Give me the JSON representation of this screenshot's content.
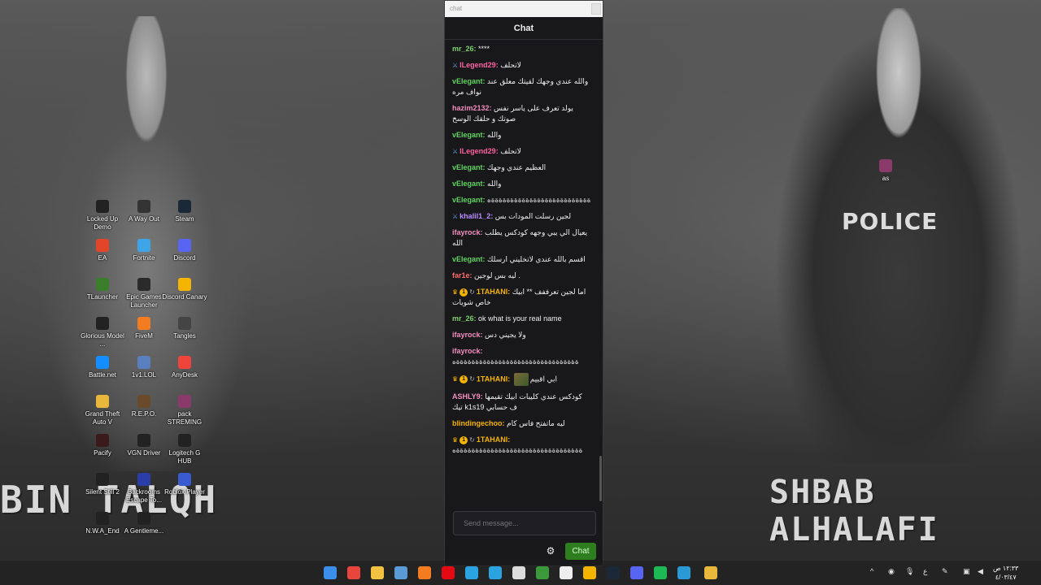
{
  "wallpaper": {
    "left_title": "BIN TALQH",
    "right_title": "SHBAB ALHALAFI",
    "police_text": "POLICE"
  },
  "desktop": {
    "icons": [
      {
        "label": "Locked Up Demo",
        "icon": "lu-icon",
        "color": "#222222"
      },
      {
        "label": "A Way Out",
        "icon": "awayout-icon",
        "color": "#333333"
      },
      {
        "label": "Steam",
        "icon": "steam-icon",
        "color": "#1b2838"
      },
      {
        "label": "EA",
        "icon": "ea-icon",
        "color": "#e2462a"
      },
      {
        "label": "Fortnite",
        "icon": "fortnite-icon",
        "color": "#3ea6e8"
      },
      {
        "label": "Discord",
        "icon": "discord-icon",
        "color": "#5865f2"
      },
      {
        "label": "TLauncher",
        "icon": "tlauncher-icon",
        "color": "#3a7d2a"
      },
      {
        "label": "Epic Games Launcher",
        "icon": "epic-icon",
        "color": "#2a2a2a"
      },
      {
        "label": "Discord Canary",
        "icon": "discord-canary-icon",
        "color": "#f5b400"
      },
      {
        "label": "Glorious Model ...",
        "icon": "glorious-icon",
        "color": "#222222"
      },
      {
        "label": "FiveM",
        "icon": "fivem-icon",
        "color": "#f47c20"
      },
      {
        "label": "Tangles",
        "icon": "tangles-icon",
        "color": "#444444"
      },
      {
        "label": "Battle.net",
        "icon": "battlenet-icon",
        "color": "#148eff"
      },
      {
        "label": "1v1.LOL",
        "icon": "1v1lol-icon",
        "color": "#5a7fbf"
      },
      {
        "label": "AnyDesk",
        "icon": "anydesk-icon",
        "color": "#ef443b"
      },
      {
        "label": "Grand Theft Auto V",
        "icon": "folder-icon",
        "color": "#e8b73c"
      },
      {
        "label": "R.E.P.O.",
        "icon": "repo-icon",
        "color": "#6a4a2a"
      },
      {
        "label": "pack STREMING",
        "icon": "winrar-icon",
        "color": "#8a3a6a"
      },
      {
        "label": "Pacify",
        "icon": "pacify-icon",
        "color": "#3a1a1a"
      },
      {
        "label": "VGN Driver",
        "icon": "vgn-icon",
        "color": "#222222"
      },
      {
        "label": "Logitech G HUB",
        "icon": "ghub-icon",
        "color": "#222222"
      },
      {
        "label": "Silent Still 2",
        "icon": "silentstill-icon",
        "color": "#222222"
      },
      {
        "label": "Backrooms Escape To...",
        "icon": "backrooms-icon",
        "color": "#2b3ea8"
      },
      {
        "label": "Roblox Player",
        "icon": "roblox-icon",
        "color": "#3a5acf"
      },
      {
        "label": "N.W.A_End",
        "icon": "nwa-icon",
        "color": "#222222"
      },
      {
        "label": "A Gentleme...",
        "icon": "gentleman-icon",
        "color": "#222222"
      },
      {
        "label": "as",
        "icon": "winrar-icon",
        "color": "#8a3a6a"
      }
    ]
  },
  "chat": {
    "window_title": "chat",
    "header": "Chat",
    "messages": [
      {
        "badges": [],
        "user": "mr_26",
        "color": "#7bd06b",
        "text": "****"
      },
      {
        "badges": [
          "sword"
        ],
        "user": "lLegend29",
        "color": "#ff5fa2",
        "text": "لاتحلف"
      },
      {
        "badges": [],
        "user": "vElegant",
        "color": "#5fd35f",
        "text": "والله عندي وجهك لقيتك معلق عند نواف مره"
      },
      {
        "badges": [],
        "user": "hazim2132",
        "color": "#f28dbf",
        "text": "يولد تعرف على ياسر نفس صوتك و حلقك الوسخ"
      },
      {
        "badges": [],
        "user": "vElegant",
        "color": "#5fd35f",
        "text": "والله"
      },
      {
        "badges": [
          "sword"
        ],
        "user": "lLegend29",
        "color": "#ff5fa2",
        "text": "لاتحلف"
      },
      {
        "badges": [],
        "user": "vElegant",
        "color": "#5fd35f",
        "text": "العظيم عندي وجهك"
      },
      {
        "badges": [],
        "user": "vElegant",
        "color": "#5fd35f",
        "text": "والله"
      },
      {
        "badges": [],
        "user": "vElegant",
        "color": "#5fd35f",
        "text": "ةةةةةةةةةةةةةةةةةةةةةةةةةةه"
      },
      {
        "badges": [
          "sword"
        ],
        "user": "khalil1_2",
        "color": "#b88cff",
        "text": "لجين رسلت المودات بس"
      },
      {
        "badges": [],
        "user": "ifayrock",
        "color": "#f28dbf",
        "text": "يعيال الي يبي وجهه كودكس يطلب الله"
      },
      {
        "badges": [],
        "user": "vElegant",
        "color": "#5fd35f",
        "text": "اقسم بالله عندي لاتخليني ارسلك"
      },
      {
        "badges": [],
        "user": "far1e",
        "color": "#ff6b6b",
        "text": "ليه بس لوجين ."
      },
      {
        "badges": [
          "crown",
          "one",
          "cycle"
        ],
        "user": "1TAHANI",
        "color": "#f5b400",
        "text": "اما لجين تعرففف ** ابيك خاص شويات"
      },
      {
        "badges": [],
        "user": "mr_26",
        "color": "#7bd06b",
        "text": "ok what is your real name"
      },
      {
        "badges": [],
        "user": "ifayrock",
        "color": "#f28dbf",
        "text": "ولا يجيني دس"
      },
      {
        "badges": [],
        "user": "ifayrock",
        "color": "#f28dbf",
        "text": "ةةةةةةةةةةةةةةةةةةةةةةةةةةةةةةةةه"
      },
      {
        "badges": [
          "crown",
          "one",
          "cycle"
        ],
        "user": "1TAHANI",
        "color": "#f5b400",
        "emote": true,
        "text": "ابي اقبيم"
      },
      {
        "badges": [],
        "user": "ASHLY9",
        "color": "#f28dbf",
        "text": "كودكس عندي كليبات ابيك تقيمها تيك k1s1ف حسابي 9"
      },
      {
        "badges": [],
        "user": "blindingechoo",
        "color": "#f5b400",
        "text": "ليه ماتفتح فاس كام"
      },
      {
        "badges": [
          "crown",
          "one",
          "cycle"
        ],
        "user": "1TAHANI",
        "color": "#f5b400",
        "text": "ةةةةةةةةةةةةةةةةةةةةةةةةةةةةةةةةةه"
      }
    ],
    "input_placeholder": "Send message...",
    "send_label": "Chat"
  },
  "taskbar": {
    "apps": [
      {
        "name": "windows-start-icon",
        "color": "#3b8eea"
      },
      {
        "name": "chrome-icon",
        "color": "#e8453c"
      },
      {
        "name": "file-explorer-icon",
        "color": "#f4c242"
      },
      {
        "name": "microsoft-store-icon",
        "color": "#5a9ad6"
      },
      {
        "name": "app-a-icon",
        "color": "#f47c20"
      },
      {
        "name": "netflix-icon",
        "color": "#e50914"
      },
      {
        "name": "telegram-icon",
        "color": "#2aa3e0"
      },
      {
        "name": "telegram-alt-icon",
        "color": "#2aa3e0"
      },
      {
        "name": "obs-icon",
        "color": "#dddddd"
      },
      {
        "name": "xbox-icon",
        "color": "#3a9a3a"
      },
      {
        "name": "capcut-icon",
        "color": "#eeeeee"
      },
      {
        "name": "discord-canary-taskbar-icon",
        "color": "#f5b400"
      },
      {
        "name": "steam-taskbar-icon",
        "color": "#1b2838"
      },
      {
        "name": "discord-taskbar-icon",
        "color": "#5865f2"
      },
      {
        "name": "spotify-icon",
        "color": "#1db954"
      },
      {
        "name": "edge-icon",
        "color": "#2a9ad6"
      },
      {
        "name": "app-badge-icon",
        "color": "#e8b73c"
      }
    ],
    "tray_chevron": "^",
    "lang": "ع",
    "clock_time": "١٢:٣٣ ص",
    "clock_date": "٤/٠٣/٤٧"
  }
}
